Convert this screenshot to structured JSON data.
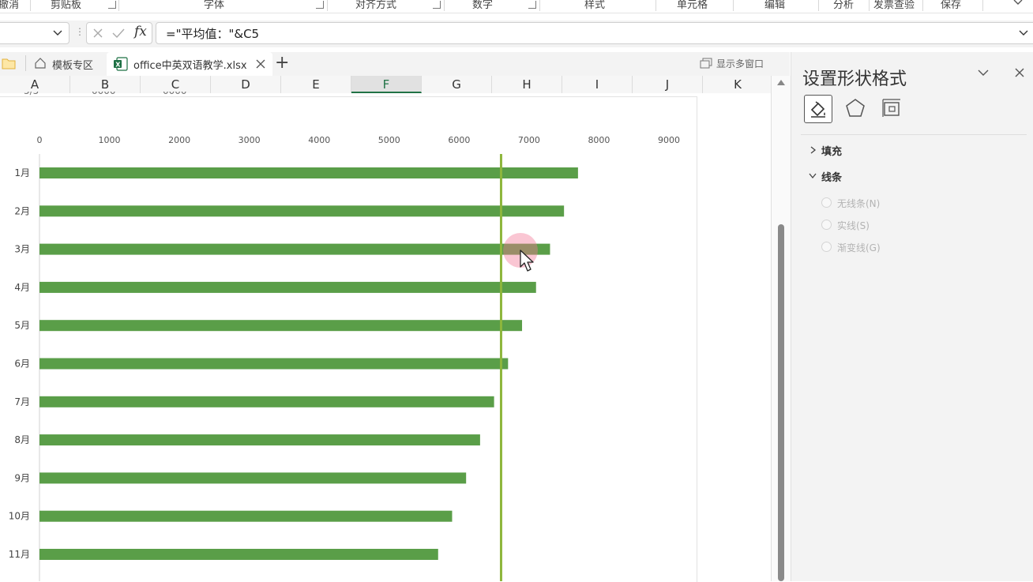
{
  "ribbon": {
    "groups": [
      "撤消",
      "剪贴板",
      "字体",
      "对齐方式",
      "数字",
      "样式",
      "单元格",
      "编辑",
      "分析",
      "发票查验",
      "保存"
    ]
  },
  "formula_bar": {
    "name_box": "",
    "fx": "fx",
    "formula": "=\"平均值：\"&C5"
  },
  "tabs": {
    "template": "模板专区",
    "file": "office中英双语教学.xlsx",
    "add": "+",
    "multi_window": "显示多窗口"
  },
  "columns": [
    "A",
    "B",
    "C",
    "D",
    "E",
    "F",
    "G",
    "H",
    "I",
    "J",
    "K"
  ],
  "selected_column": "F",
  "chart_data": {
    "type": "bar",
    "orientation": "horizontal",
    "categories": [
      "1月",
      "2月",
      "3月",
      "4月",
      "5月",
      "6月",
      "7月",
      "8月",
      "9月",
      "10月",
      "11月"
    ],
    "values": [
      7700,
      7500,
      7300,
      7100,
      6900,
      6700,
      6500,
      6300,
      6100,
      5900,
      5700
    ],
    "x_ticks": [
      "0",
      "1000",
      "2000",
      "3000",
      "4000",
      "5000",
      "6000",
      "7000",
      "8000",
      "9000"
    ],
    "xlim": [
      0,
      9000
    ],
    "average_line": 6600,
    "bar_color": "#5a9e48",
    "line_color": "#8db63c"
  },
  "panel": {
    "title": "设置形状格式",
    "tabs": [
      "fill-line-icon",
      "shape-effects-icon",
      "size-properties-icon"
    ],
    "sections": [
      {
        "label": "填充",
        "expanded": false
      },
      {
        "label": "线条",
        "expanded": true
      }
    ],
    "line_options": [
      "无线条(N)",
      "实线(S)",
      "渐变线(G)"
    ]
  }
}
